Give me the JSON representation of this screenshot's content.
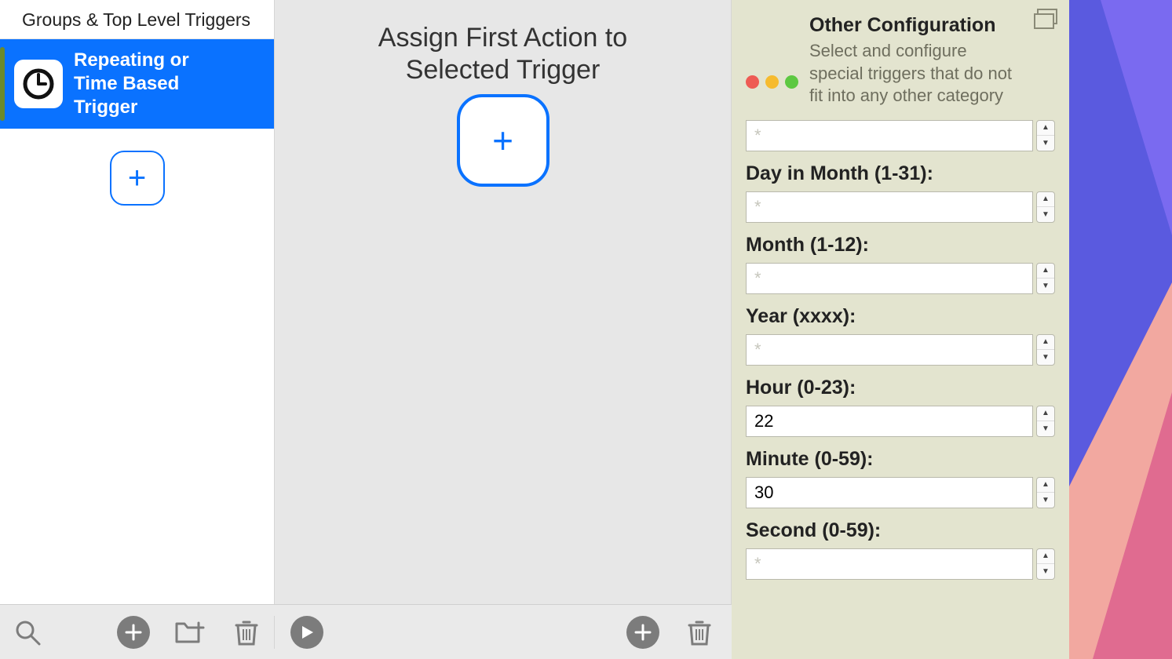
{
  "sidebar": {
    "header": "Groups & Top Level Triggers",
    "items": [
      {
        "label": "Repeating or Time Based Trigger"
      }
    ],
    "add_label": "+"
  },
  "center": {
    "title_line1": "Assign First Action to",
    "title_line2": "Selected Trigger",
    "add_label": "+"
  },
  "config": {
    "title": "Other Configuration",
    "subtitle": "Select and configure special triggers that do not  fit into any other category",
    "fields": [
      {
        "label": "",
        "value": "",
        "placeholder": "*"
      },
      {
        "label": "Day in Month (1-31):",
        "value": "",
        "placeholder": "*"
      },
      {
        "label": "Month (1-12):",
        "value": "",
        "placeholder": "*"
      },
      {
        "label": "Year (xxxx):",
        "value": "",
        "placeholder": "*"
      },
      {
        "label": "Hour (0-23):",
        "value": "22",
        "placeholder": ""
      },
      {
        "label": "Minute (0-59):",
        "value": "30",
        "placeholder": ""
      },
      {
        "label": "Second (0-59):",
        "value": "",
        "placeholder": "*"
      }
    ]
  },
  "icons": {
    "clock": "clock-icon",
    "plus": "+"
  }
}
